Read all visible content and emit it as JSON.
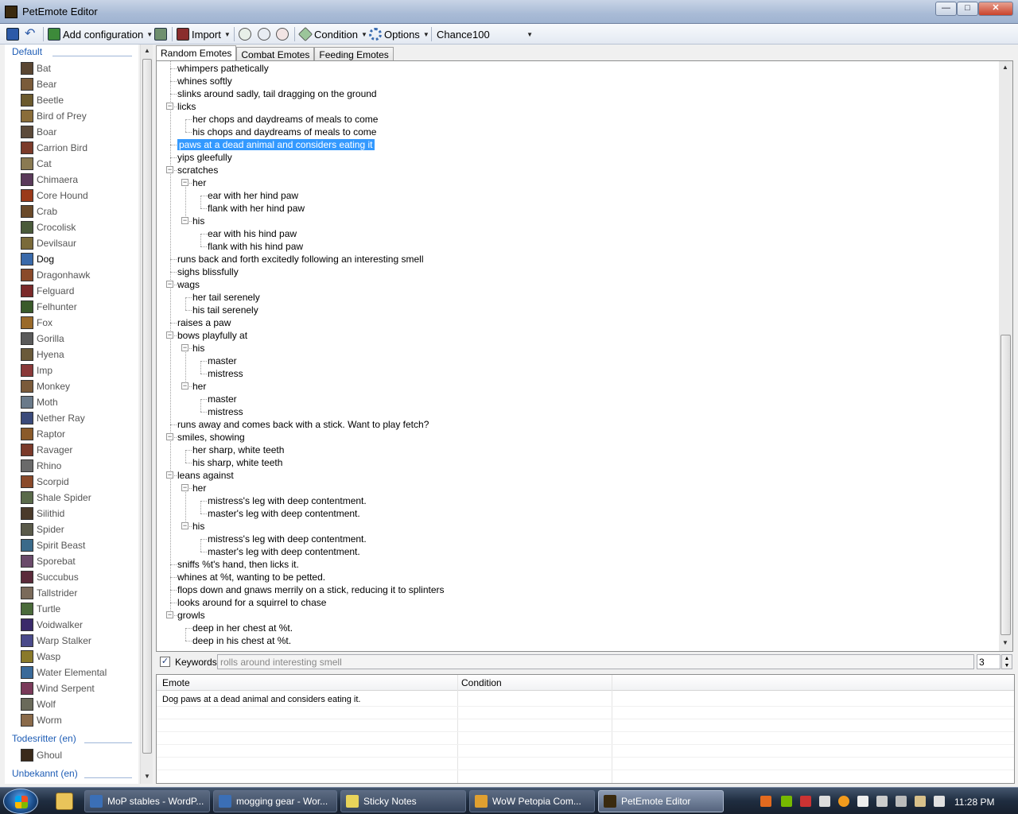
{
  "window": {
    "title": "PetEmote Editor"
  },
  "toolbar": {
    "add_config": "Add configuration",
    "import": "Import",
    "condition": "Condition",
    "options": "Options",
    "chance_label": "Chance",
    "chance_value": "100"
  },
  "sidebar": {
    "groups": [
      {
        "name": "Default",
        "items": [
          "Bat",
          "Bear",
          "Beetle",
          "Bird of Prey",
          "Boar",
          "Carrion Bird",
          "Cat",
          "Chimaera",
          "Core Hound",
          "Crab",
          "Crocolisk",
          "Devilsaur",
          "Dog",
          "Dragonhawk",
          "Felguard",
          "Felhunter",
          "Fox",
          "Gorilla",
          "Hyena",
          "Imp",
          "Monkey",
          "Moth",
          "Nether Ray",
          "Raptor",
          "Ravager",
          "Rhino",
          "Scorpid",
          "Shale Spider",
          "Silithid",
          "Spider",
          "Spirit Beast",
          "Sporebat",
          "Succubus",
          "Tallstrider",
          "Turtle",
          "Voidwalker",
          "Warp Stalker",
          "Wasp",
          "Water Elemental",
          "Wind Serpent",
          "Wolf",
          "Worm"
        ]
      },
      {
        "name": "Todesritter (en)",
        "items": [
          "Ghoul"
        ]
      },
      {
        "name": "Unbekannt (en)",
        "items": []
      }
    ],
    "selected": "Dog",
    "colors": {
      "group_header": "#1d5cb5",
      "item": "#555555"
    }
  },
  "tabs": [
    "Random Emotes",
    "Combat Emotes",
    "Feeding Emotes"
  ],
  "active_tab": "Random Emotes",
  "tree": [
    {
      "text": "whimpers pathetically",
      "depth": 0,
      "expander": false
    },
    {
      "text": "whines softly",
      "depth": 0,
      "expander": false
    },
    {
      "text": "slinks around sadly, tail dragging on the ground",
      "depth": 0,
      "expander": false
    },
    {
      "text": "licks",
      "depth": 0,
      "expander": true
    },
    {
      "text": "her chops and daydreams of meals to come",
      "depth": 1,
      "expander": false
    },
    {
      "text": "his chops and daydreams of meals to come",
      "depth": 1,
      "expander": false
    },
    {
      "text": "paws at a dead animal and considers eating it",
      "depth": 0,
      "expander": false,
      "selected": true
    },
    {
      "text": "yips gleefully",
      "depth": 0,
      "expander": false
    },
    {
      "text": "scratches",
      "depth": 0,
      "expander": true
    },
    {
      "text": "her",
      "depth": 1,
      "expander": true
    },
    {
      "text": "ear with her hind paw",
      "depth": 2,
      "expander": false
    },
    {
      "text": "flank with her hind paw",
      "depth": 2,
      "expander": false
    },
    {
      "text": "his",
      "depth": 1,
      "expander": true
    },
    {
      "text": "ear with his hind paw",
      "depth": 2,
      "expander": false
    },
    {
      "text": "flank with his hind paw",
      "depth": 2,
      "expander": false
    },
    {
      "text": "runs back and forth excitedly following an interesting smell",
      "depth": 0,
      "expander": false
    },
    {
      "text": "sighs blissfully",
      "depth": 0,
      "expander": false
    },
    {
      "text": "wags",
      "depth": 0,
      "expander": true
    },
    {
      "text": "her tail serenely",
      "depth": 1,
      "expander": false
    },
    {
      "text": "his tail serenely",
      "depth": 1,
      "expander": false
    },
    {
      "text": "raises a paw",
      "depth": 0,
      "expander": false
    },
    {
      "text": "bows playfully at",
      "depth": 0,
      "expander": true
    },
    {
      "text": "his",
      "depth": 1,
      "expander": true
    },
    {
      "text": "master",
      "depth": 2,
      "expander": false
    },
    {
      "text": "mistress",
      "depth": 2,
      "expander": false
    },
    {
      "text": "her",
      "depth": 1,
      "expander": true
    },
    {
      "text": "master",
      "depth": 2,
      "expander": false
    },
    {
      "text": "mistress",
      "depth": 2,
      "expander": false
    },
    {
      "text": "runs away and comes back with a stick. Want to play fetch?",
      "depth": 0,
      "expander": false
    },
    {
      "text": "smiles, showing",
      "depth": 0,
      "expander": true
    },
    {
      "text": "her sharp, white teeth",
      "depth": 1,
      "expander": false
    },
    {
      "text": "his sharp, white teeth",
      "depth": 1,
      "expander": false
    },
    {
      "text": "leans against",
      "depth": 0,
      "expander": true
    },
    {
      "text": "her",
      "depth": 1,
      "expander": true
    },
    {
      "text": "mistress's leg with deep contentment.",
      "depth": 2,
      "expander": false
    },
    {
      "text": "master's leg with deep contentment.",
      "depth": 2,
      "expander": false
    },
    {
      "text": "his",
      "depth": 1,
      "expander": true
    },
    {
      "text": "mistress's leg with deep contentment.",
      "depth": 2,
      "expander": false
    },
    {
      "text": "master's leg with deep contentment.",
      "depth": 2,
      "expander": false
    },
    {
      "text": "sniffs %t's hand, then licks it.",
      "depth": 0,
      "expander": false
    },
    {
      "text": "whines at %t, wanting to be petted.",
      "depth": 0,
      "expander": false
    },
    {
      "text": "flops down and gnaws merrily on a stick, reducing it to splinters",
      "depth": 0,
      "expander": false
    },
    {
      "text": "looks around for a squirrel to chase",
      "depth": 0,
      "expander": false
    },
    {
      "text": "growls",
      "depth": 0,
      "expander": true
    },
    {
      "text": "deep in her chest at %t.",
      "depth": 1,
      "expander": false
    },
    {
      "text": "deep in his chest at %t.",
      "depth": 1,
      "expander": false
    }
  ],
  "keywords": {
    "label": "Keywords",
    "checked": true,
    "value": "rolls around interesting smell",
    "number": "3"
  },
  "emote_table": {
    "columns": [
      "Emote",
      "Condition"
    ],
    "rows": [
      {
        "emote": "Dog paws at a dead animal and considers eating it.",
        "condition": ""
      }
    ]
  },
  "taskbar": {
    "tasks": [
      {
        "label": "MoP stables - WordP...",
        "active": false
      },
      {
        "label": "mogging gear - Wor...",
        "active": false
      },
      {
        "label": "Sticky Notes",
        "active": false
      },
      {
        "label": "WoW Petopia Com...",
        "active": false
      },
      {
        "label": "PetEmote Editor",
        "active": true
      }
    ],
    "clock": "11:28 PM"
  }
}
